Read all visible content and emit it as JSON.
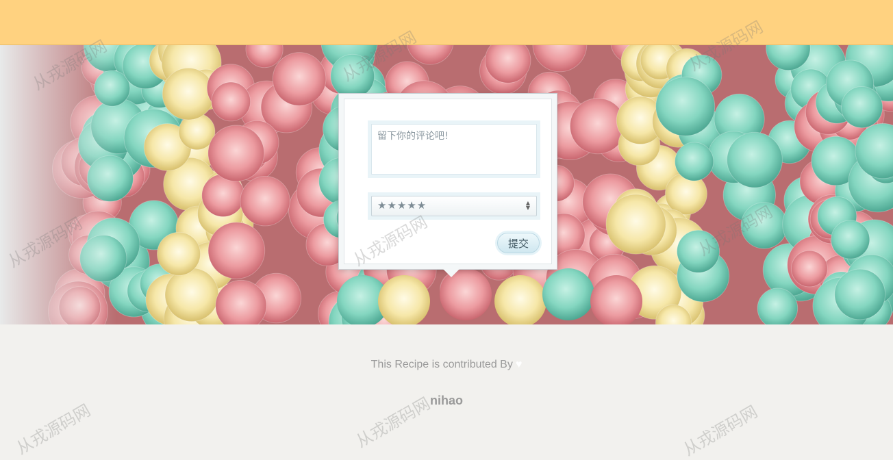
{
  "comment_form": {
    "placeholder": "留下你的评论吧!",
    "rating_selected": "★★★★★",
    "submit_label": "提交"
  },
  "footer": {
    "credit_text": "This Recipe is contributed By",
    "heart_icon": "♥",
    "author": "nihao"
  },
  "watermark": {
    "text": "从戎源码网"
  },
  "colors": {
    "topbar": "#ffd280",
    "page_background": "#f2f1ee",
    "frosting_pink": "#e98f95",
    "frosting_mint": "#7fd4bf",
    "frosting_cream": "#f5e6a8"
  },
  "hero_image": {
    "subject": "rainbow-frosting-cake"
  }
}
